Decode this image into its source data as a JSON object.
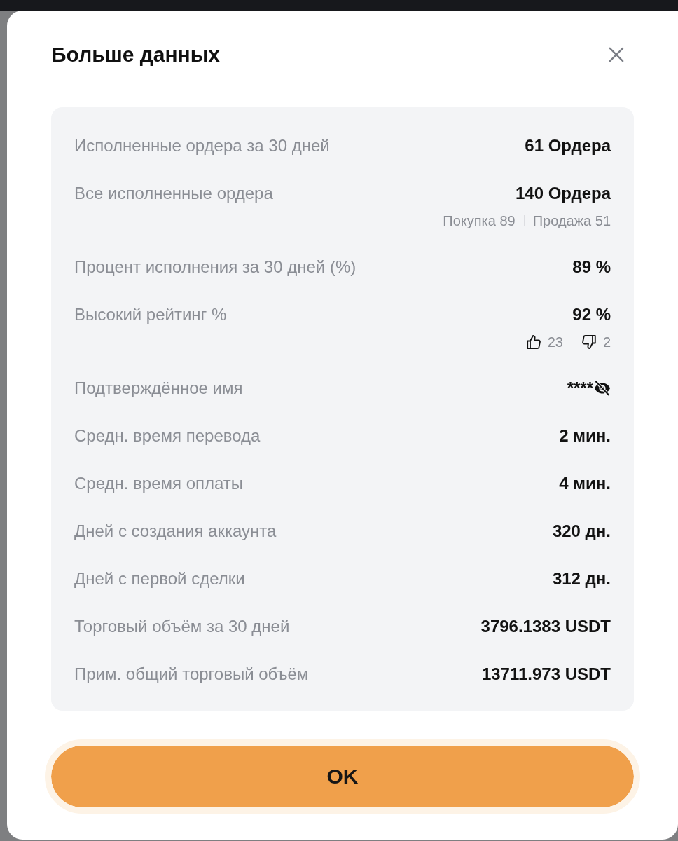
{
  "dialog": {
    "title": "Больше данных"
  },
  "stats": [
    {
      "kind": "plain",
      "label": "Исполненные ордера за 30 дней",
      "value": "61 Ордера"
    },
    {
      "kind": "split",
      "label": "Все исполненные ордера",
      "value": "140 Ордера",
      "details": [
        "Покупка 89",
        "Продажа 51"
      ]
    },
    {
      "kind": "plain",
      "label": "Процент исполнения за 30 дней (%)",
      "value": "89 %"
    },
    {
      "kind": "votes",
      "label": "Высокий рейтинг %",
      "value": "92 %",
      "votes": [
        {
          "kind": "up",
          "count": "23"
        },
        {
          "kind": "down",
          "count": "2"
        }
      ]
    },
    {
      "kind": "masked",
      "label": "Подтверждённое имя",
      "value": "****",
      "hidden": true
    },
    {
      "kind": "plain",
      "label": "Средн. время перевода",
      "value": "2 мин."
    },
    {
      "kind": "plain",
      "label": "Средн. время оплаты",
      "value": "4 мин."
    },
    {
      "kind": "plain",
      "label": "Дней с создания аккаунта",
      "value": "320 дн."
    },
    {
      "kind": "plain",
      "label": "Дней с первой сделки",
      "value": "312 дн."
    },
    {
      "kind": "plain",
      "label": "Торговый объём за 30 дней",
      "value": "3796.1383 USDT"
    },
    {
      "kind": "plain",
      "label": "Прим. общий торговый объём",
      "value": "13711.973 USDT"
    }
  ],
  "confirm_button": {
    "label": "OK"
  }
}
